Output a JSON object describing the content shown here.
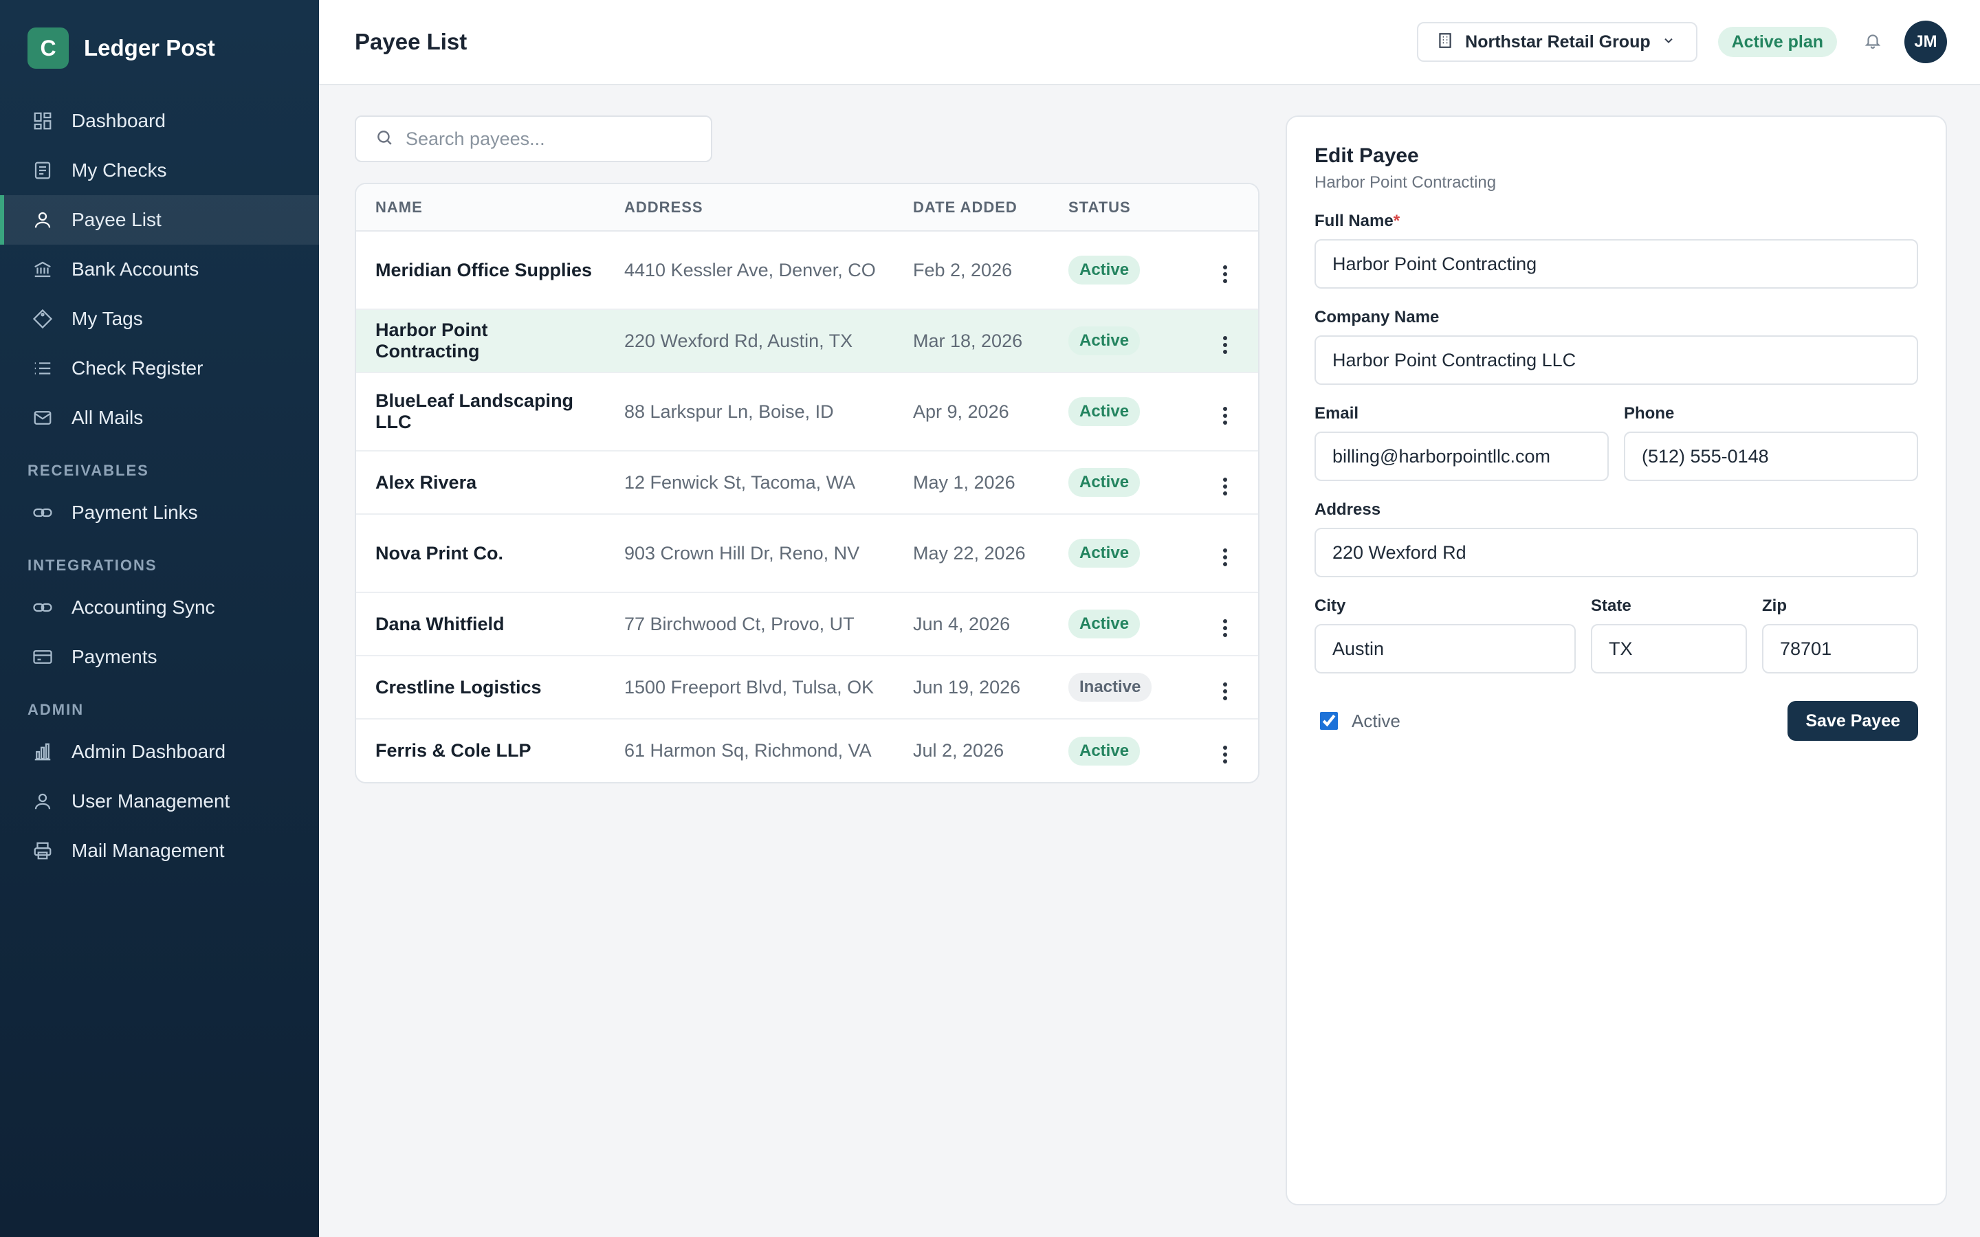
{
  "brand": {
    "logo_letter": "C",
    "name": "Ledger Post"
  },
  "sidebar": {
    "items": [
      {
        "label": "Dashboard",
        "icon": "dashboard-icon"
      },
      {
        "label": "My Checks",
        "icon": "document-icon"
      },
      {
        "label": "Payee List",
        "icon": "user-icon",
        "active": true
      },
      {
        "label": "Bank Accounts",
        "icon": "bank-icon"
      },
      {
        "label": "My Tags",
        "icon": "tag-icon"
      },
      {
        "label": "Check Register",
        "icon": "list-icon"
      },
      {
        "label": "All Mails",
        "icon": "mail-icon"
      }
    ],
    "sections": [
      {
        "title": "RECEIVABLES",
        "items": [
          {
            "label": "Payment Links",
            "icon": "link-icon"
          }
        ]
      },
      {
        "title": "INTEGRATIONS",
        "items": [
          {
            "label": "Accounting Sync",
            "icon": "link-icon"
          },
          {
            "label": "Payments",
            "icon": "card-icon"
          }
        ]
      },
      {
        "title": "ADMIN",
        "items": [
          {
            "label": "Admin Dashboard",
            "icon": "bar-chart-icon"
          },
          {
            "label": "User Management",
            "icon": "user-icon"
          },
          {
            "label": "Mail Management",
            "icon": "printer-icon"
          }
        ]
      }
    ]
  },
  "header": {
    "title": "Payee List",
    "org_name": "Northstar Retail Group",
    "plan_badge": "Active plan",
    "avatar_initials": "JM"
  },
  "search": {
    "placeholder": "Search payees...",
    "value": ""
  },
  "table": {
    "columns": [
      "NAME",
      "ADDRESS",
      "DATE ADDED",
      "STATUS"
    ],
    "rows": [
      {
        "name": "Meridian Office Supplies",
        "address": "4410 Kessler Ave, Denver, CO",
        "date": "Feb 2, 2026",
        "status": "Active"
      },
      {
        "name": "Harbor Point Contracting",
        "address": "220 Wexford Rd, Austin, TX",
        "date": "Mar 18, 2026",
        "status": "Active",
        "selected": true
      },
      {
        "name": "BlueLeaf Landscaping LLC",
        "address": "88 Larkspur Ln, Boise, ID",
        "date": "Apr 9, 2026",
        "status": "Active"
      },
      {
        "name": "Alex Rivera",
        "address": "12 Fenwick St, Tacoma, WA",
        "date": "May 1, 2026",
        "status": "Active"
      },
      {
        "name": "Nova Print Co.",
        "address": "903 Crown Hill Dr, Reno, NV",
        "date": "May 22, 2026",
        "status": "Active"
      },
      {
        "name": "Dana Whitfield",
        "address": "77 Birchwood Ct, Provo, UT",
        "date": "Jun 4, 2026",
        "status": "Active"
      },
      {
        "name": "Crestline Logistics",
        "address": "1500 Freeport Blvd, Tulsa, OK",
        "date": "Jun 19, 2026",
        "status": "Inactive"
      },
      {
        "name": "Ferris & Cole LLP",
        "address": "61 Harmon Sq, Richmond, VA",
        "date": "Jul 2, 2026",
        "status": "Active"
      }
    ]
  },
  "edit_panel": {
    "title": "Edit Payee",
    "subtitle": "Harbor Point Contracting",
    "full_name_label": "Full Name",
    "full_name_required": "*",
    "full_name_value": "Harbor Point Contracting",
    "company_label": "Company Name",
    "company_value": "Harbor Point Contracting LLC",
    "email_label": "Email",
    "email_value": "billing@harborpointllc.com",
    "phone_label": "Phone",
    "phone_value": "(512) 555-0148",
    "address_label": "Address",
    "address_value": "220 Wexford Rd",
    "city_label": "City",
    "city_value": "Austin",
    "state_label": "State",
    "state_value": "TX",
    "zip_label": "Zip",
    "zip_value": "78701",
    "active_label": "Active",
    "active_checked": true,
    "save_label": "Save Payee"
  },
  "colors": {
    "sidebar_bg": "#16324a",
    "accent_green": "#2f8a6a",
    "badge_green_bg": "#dff3ea",
    "badge_green_text": "#23845f",
    "primary_button": "#17324a",
    "selected_row": "#e8f5ef"
  }
}
